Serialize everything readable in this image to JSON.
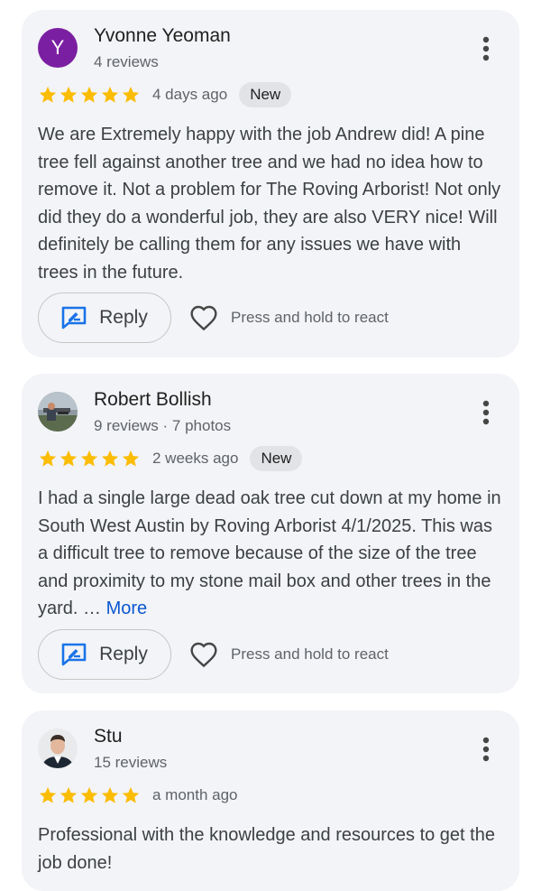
{
  "reviews": [
    {
      "author": "Yvonne Yeoman",
      "avatar_letter": "Y",
      "meta": "4 reviews",
      "rating": 5,
      "time": "4 days ago",
      "badge": "New",
      "text": "We are Extremely happy with the job Andrew did! A pine tree fell against another tree and we had no idea how to remove it. Not a problem for The Roving Arborist! Not only did they do a wonderful job, they are also VERY nice! Will definitely be calling them for any issues we have with trees in the future.",
      "reply_label": "Reply",
      "react_label": "Press and hold to react"
    },
    {
      "author": "Robert Bollish",
      "meta": "9 reviews · 7 photos",
      "rating": 5,
      "time": "2 weeks ago",
      "badge": "New",
      "text": "I had a single large dead oak tree cut down at my home in South West Austin by Roving Arborist 4/1/2025. This was a difficult tree to remove because of the size of the tree and proximity to my stone mail box and other trees in the yard. … ",
      "more_label": "More",
      "reply_label": "Reply",
      "react_label": "Press and hold to react"
    },
    {
      "author": "Stu",
      "meta": "15 reviews",
      "rating": 5,
      "time": "a month ago",
      "text": "Professional with the knowledge and resources to get the job done!"
    }
  ],
  "colors": {
    "star": "#fbbc04",
    "card_bg": "#f3f4f7",
    "link": "#0b57d0",
    "reply_icon": "#1a73e8",
    "avatar_y": "#7b1fa2"
  },
  "icons": [
    "star-icon",
    "more-vert-icon",
    "reply-edit-icon",
    "heart-outline-icon"
  ]
}
